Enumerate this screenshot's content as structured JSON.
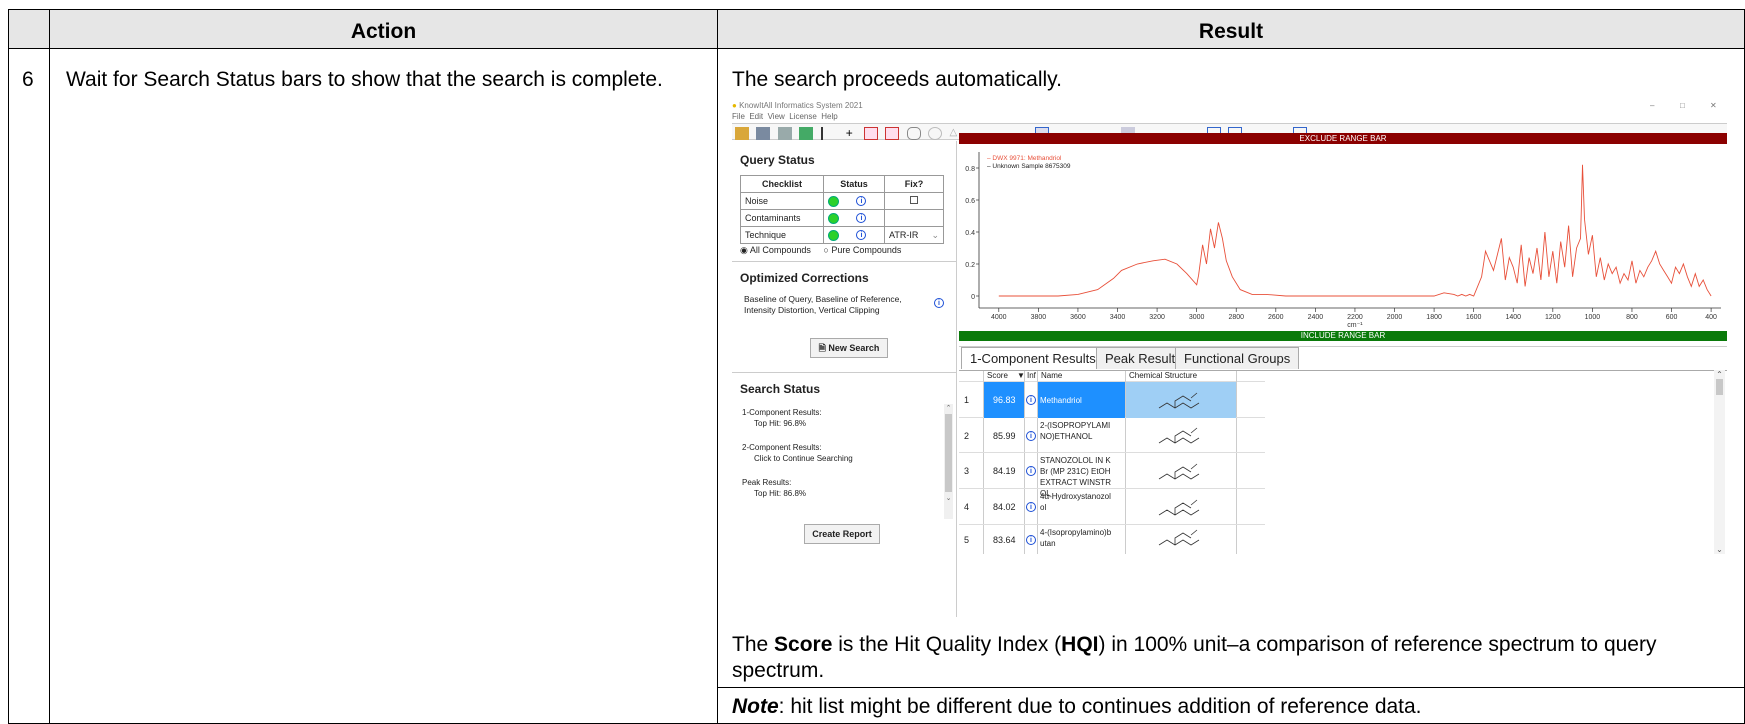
{
  "table": {
    "header_action": "Action",
    "header_result": "Result",
    "step_number": "6",
    "action_text": "Wait for Search Status bars to show that the search is complete.",
    "result_intro": "The search proceeds automatically.",
    "score_prefix": "The ",
    "score_bold": "Score",
    "score_mid": " is the Hit Quality Index (",
    "score_hqi": "HQI",
    "score_rest": ") in 100% unit–a comparison of reference spectrum to query spectrum.",
    "note_label": "Note",
    "note_text": ": hit list might be different due to continues addition of reference data."
  },
  "app": {
    "title": "KnowItAll Informatics System 2021",
    "menu": [
      "File",
      "Edit",
      "View",
      "License",
      "Help"
    ],
    "window_controls": [
      "–",
      "□",
      "✕"
    ]
  },
  "query_status": {
    "heading": "Query Status",
    "columns": [
      "Checklist",
      "Status",
      "Fix?"
    ],
    "rows": [
      {
        "label": "Noise",
        "fix": ""
      },
      {
        "label": "Contaminants",
        "fix": ""
      },
      {
        "label": "Technique",
        "fix": "ATR-IR"
      }
    ],
    "radio_all": "All Compounds",
    "radio_pure": "Pure Compounds"
  },
  "corrections": {
    "heading": "Optimized Corrections",
    "text": "Baseline of Query, Baseline of Reference, Intensity Distortion, Vertical Clipping",
    "new_search": "New Search"
  },
  "search_status": {
    "heading": "Search Status",
    "lines": [
      {
        "title": "1-Component Results:",
        "detail": "Top Hit: 96.8%"
      },
      {
        "title": "2-Component Results:",
        "detail": "Click to Continue Searching"
      },
      {
        "title": "Peak Results:",
        "detail": "Top Hit: 86.8%"
      }
    ],
    "create_report": "Create Report"
  },
  "spectrum": {
    "exclude_bar": "EXCLUDE RANGE BAR",
    "include_bar": "INCLUDE RANGE BAR",
    "legend_ref": "DWX 9971: Methandriol",
    "legend_query": "Unknown Sample 8675309",
    "x_unit": "cm⁻¹",
    "colors": {
      "reference": "#e8503a",
      "query": "#222222",
      "exclude": "#8b0000",
      "include": "#0a7a0a"
    }
  },
  "chart_data": {
    "type": "line",
    "xlabel": "cm⁻¹",
    "xlim": [
      4100,
      350
    ],
    "ylim": [
      -0.05,
      0.9
    ],
    "x_ticks": [
      "4000",
      "3800",
      "3600",
      "3400",
      "3200",
      "3000",
      "2800",
      "2600",
      "2400",
      "2200",
      "2000",
      "1800",
      "1600",
      "1400",
      "1200",
      "1000",
      "800",
      "600",
      "400"
    ],
    "y_ticks": [
      "0",
      "0.2",
      "0.4",
      "0.6",
      "0.8"
    ],
    "series": [
      {
        "name": "DWX 9971: Methandriol",
        "x": [
          4000,
          3900,
          3800,
          3700,
          3600,
          3500,
          3420,
          3380,
          3300,
          3220,
          3160,
          3100,
          3050,
          3000,
          2990,
          2970,
          2950,
          2930,
          2910,
          2890,
          2870,
          2850,
          2820,
          2780,
          2720,
          2650,
          2550,
          2450,
          2350,
          2250,
          2150,
          2050,
          1950,
          1850,
          1800,
          1750,
          1700,
          1680,
          1660,
          1640,
          1620,
          1600,
          1560,
          1540,
          1500,
          1460,
          1440,
          1420,
          1400,
          1380,
          1360,
          1340,
          1320,
          1300,
          1280,
          1260,
          1240,
          1220,
          1200,
          1180,
          1160,
          1140,
          1120,
          1100,
          1080,
          1060,
          1055,
          1050,
          1040,
          1020,
          1000,
          980,
          960,
          940,
          920,
          900,
          880,
          860,
          840,
          820,
          800,
          780,
          760,
          740,
          720,
          700,
          680,
          660,
          640,
          620,
          600,
          580,
          560,
          540,
          520,
          500,
          480,
          460,
          440,
          420,
          400
        ],
        "y": [
          0.0,
          0.0,
          0.0,
          0.0,
          0.01,
          0.04,
          0.11,
          0.16,
          0.2,
          0.22,
          0.23,
          0.2,
          0.14,
          0.07,
          0.13,
          0.32,
          0.2,
          0.42,
          0.3,
          0.46,
          0.36,
          0.22,
          0.12,
          0.04,
          0.01,
          0.01,
          0.0,
          0.0,
          0.0,
          0.0,
          0.0,
          0.0,
          0.0,
          0.0,
          0.0,
          0.02,
          0.01,
          0.0,
          0.01,
          0.0,
          0.01,
          0.0,
          0.12,
          0.28,
          0.16,
          0.36,
          0.1,
          0.24,
          0.18,
          0.08,
          0.32,
          0.06,
          0.24,
          0.14,
          0.3,
          0.1,
          0.4,
          0.12,
          0.28,
          0.08,
          0.34,
          0.18,
          0.44,
          0.12,
          0.3,
          0.36,
          0.58,
          0.82,
          0.48,
          0.26,
          0.38,
          0.12,
          0.24,
          0.1,
          0.2,
          0.14,
          0.18,
          0.08,
          0.14,
          0.1,
          0.22,
          0.08,
          0.16,
          0.12,
          0.18,
          0.22,
          0.28,
          0.2,
          0.16,
          0.12,
          0.08,
          0.18,
          0.14,
          0.2,
          0.12,
          0.06,
          0.14,
          0.06,
          0.1,
          0.04,
          0.0
        ]
      }
    ]
  },
  "results": {
    "tabs": [
      "1-Component Results",
      "Peak Results",
      "Functional Groups"
    ],
    "columns": [
      "Score",
      "Inf",
      "Name",
      "Chemical Structure"
    ],
    "rows": [
      {
        "rank": "1",
        "score": "96.83",
        "name": "Methandriol"
      },
      {
        "rank": "2",
        "score": "85.99",
        "name": "2-(ISOPROPYLAMINO)ETHANOL"
      },
      {
        "rank": "3",
        "score": "84.19",
        "name": "STANOZOLOL IN KBr (MP 231C) EtOH EXTRACT WINSTROL"
      },
      {
        "rank": "4",
        "score": "84.02",
        "name": "4α-Hydroxystanozolol"
      },
      {
        "rank": "5",
        "score": "83.64",
        "name": "4-(Isopropylamino)butan"
      }
    ]
  }
}
